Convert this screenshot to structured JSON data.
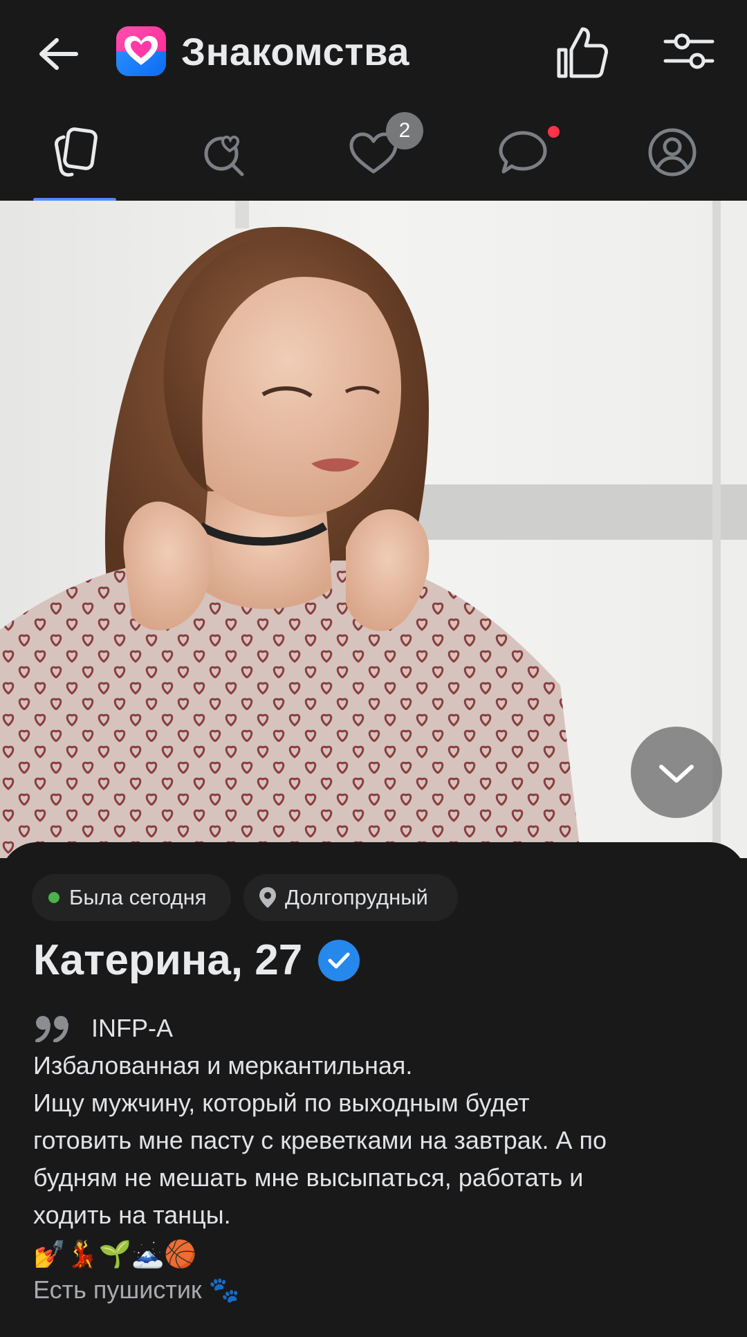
{
  "header": {
    "title": "Знакомства"
  },
  "tabs": {
    "likes_badge": "2"
  },
  "profile": {
    "status": "Была сегодня",
    "city": "Долгопрудный",
    "name_age": "Катерина, 27",
    "bio_type": "INFP-A",
    "bio_lines": [
      "Избалованная и меркантильная.",
      "Ищу мужчину, который по выходным будет",
      "готовить мне пасту с креветками на завтрак. А по",
      "будням не мешать мне высыпаться, работать и",
      "ходить на танцы."
    ],
    "emojis": "💅💃🌱🗻🏀",
    "pet": "Есть пушистик 🐾"
  },
  "colors": {
    "accent": "#4f8df5",
    "verified": "#2688eb",
    "online": "#4bb34b",
    "notification_dot": "#ff3347",
    "background": "#19191a"
  },
  "icons": {
    "back": "arrow-left-icon",
    "like": "thumb-up-icon",
    "filter": "sliders-icon",
    "tab1": "cards-icon",
    "tab2": "heart-search-icon",
    "tab3": "heart-icon",
    "tab4": "chat-icon",
    "tab5": "profile-icon",
    "expand": "chevron-down-icon",
    "location": "pin-icon",
    "quote": "quote-icon",
    "verified": "checkmark-icon"
  }
}
